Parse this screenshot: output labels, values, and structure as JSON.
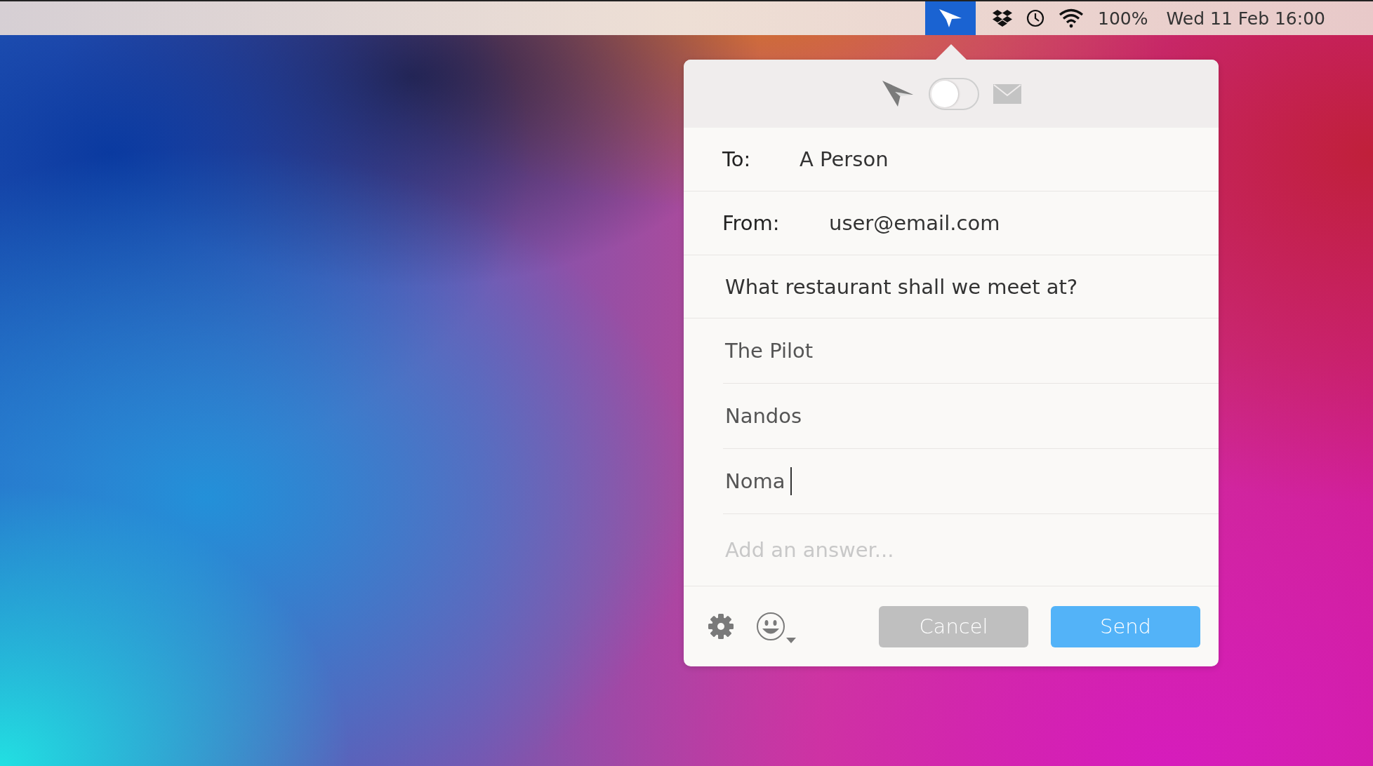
{
  "menu_bar": {
    "app_icon_selected": true,
    "battery": "100%",
    "clock": "Wed 11 Feb 16:00"
  },
  "popover": {
    "mode_toggle": {
      "on": false
    },
    "to": {
      "label": "To:",
      "value": "A Person"
    },
    "from": {
      "label": "From:",
      "value": "user@email.com"
    },
    "question": "What restaurant shall we meet at?",
    "answers": [
      {
        "text": "The Pilot",
        "focused": false
      },
      {
        "text": "Nandos",
        "focused": false
      },
      {
        "text": "Noma",
        "focused": true
      }
    ],
    "new_answer": {
      "placeholder": "Add an answer..."
    },
    "buttons": [
      {
        "label": "Cancel",
        "kind": "secondary"
      },
      {
        "label": "Send",
        "kind": "primary"
      }
    ]
  }
}
